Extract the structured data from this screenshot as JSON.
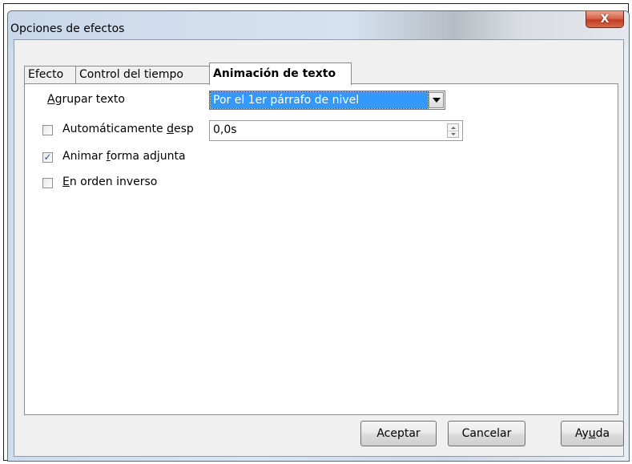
{
  "window": {
    "title": "Opciones de efectos",
    "close_glyph": "X"
  },
  "tabs": [
    {
      "label": "Efecto",
      "active": false
    },
    {
      "label": "Control del tiempo",
      "active": false
    },
    {
      "label": "Animación de texto",
      "active": true
    }
  ],
  "text_animation": {
    "group_text": {
      "label_mnemonic": "A",
      "label_rest": "grupar texto",
      "selected": "Por el 1er párrafo de nivel"
    },
    "auto_after": {
      "label_before": "Automáticamente ",
      "label_mnemonic": "d",
      "label_after": "esp",
      "checked": false,
      "value": "0,0s"
    },
    "animate_shape": {
      "label_before": "Animar ",
      "label_mnemonic": "f",
      "label_after": "orma adjunta",
      "checked": true
    },
    "reverse_order": {
      "label_mnemonic": "E",
      "label_after": "n orden inverso",
      "checked": false
    }
  },
  "buttons": {
    "ok": "Aceptar",
    "cancel": "Cancelar",
    "help_before": "Ay",
    "help_mnemonic": "u",
    "help_after": "da"
  },
  "check_glyph": "✓",
  "colors": {
    "selection": "#3399ff",
    "close_button": "#c23c22",
    "dialog_bg": "#f0f0f0"
  }
}
